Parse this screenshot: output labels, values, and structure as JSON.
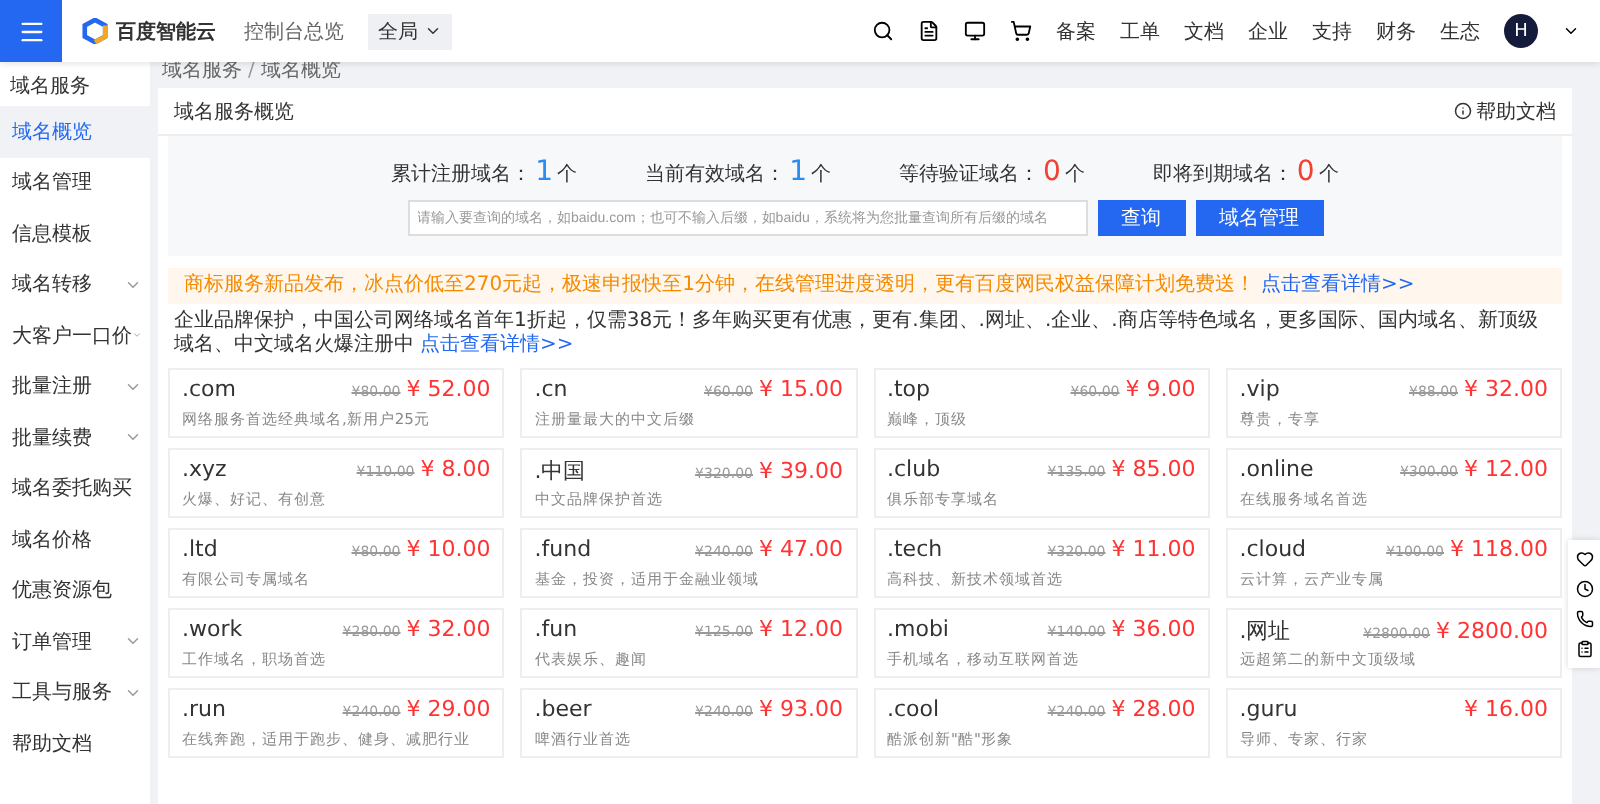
{
  "topbar": {
    "logo": "百度智能云",
    "console": "控制台总览",
    "region": "全局",
    "menu": [
      "备案",
      "工单",
      "文档",
      "企业",
      "支持",
      "财务",
      "生态"
    ],
    "avatar": "H"
  },
  "sidebar": {
    "title": "域名服务",
    "items": [
      {
        "label": "域名概览",
        "selected": true,
        "expandable": false
      },
      {
        "label": "域名管理",
        "selected": false,
        "expandable": false
      },
      {
        "label": "信息模板",
        "selected": false,
        "expandable": false
      },
      {
        "label": "域名转移",
        "selected": false,
        "expandable": true
      },
      {
        "label": "大客户一口价",
        "selected": false,
        "expandable": true
      },
      {
        "label": "批量注册",
        "selected": false,
        "expandable": true
      },
      {
        "label": "批量续费",
        "selected": false,
        "expandable": true
      },
      {
        "label": "域名委托购买",
        "selected": false,
        "expandable": false
      },
      {
        "label": "域名价格",
        "selected": false,
        "expandable": false
      },
      {
        "label": "优惠资源包",
        "selected": false,
        "expandable": false
      },
      {
        "label": "订单管理",
        "selected": false,
        "expandable": true
      },
      {
        "label": "工具与服务",
        "selected": false,
        "expandable": true
      },
      {
        "label": "帮助文档",
        "selected": false,
        "expandable": false
      }
    ]
  },
  "breadcrumb": {
    "items": [
      "域名服务",
      "域名概览"
    ],
    "separator": "/"
  },
  "header": {
    "title": "域名服务概览",
    "help": "帮助文档"
  },
  "stats": [
    {
      "label": "累计注册域名：",
      "value": "1",
      "unit": "个",
      "color": "#2a8cf0"
    },
    {
      "label": "当前有效域名：",
      "value": "1",
      "unit": "个",
      "color": "#2a8cf0"
    },
    {
      "label": "等待验证域名：",
      "value": "0",
      "unit": "个",
      "color": "#f04134"
    },
    {
      "label": "即将到期域名：",
      "value": "0",
      "unit": "个",
      "color": "#f04134"
    }
  ],
  "search": {
    "placeholder": "请输入要查询的域名，如baidu.com；也可不输入后缀，如baidu，系统将为您批量查询所有后缀的域名",
    "buttons": [
      "查询",
      "域名管理"
    ]
  },
  "notices": [
    {
      "text": "商标服务新品发布，冰点价低至270元起，极速申报快至1分钟，在线管理进度透明，更有百度网民权益保障计划免费送！",
      "link": "点击查看详情>>",
      "kind": "warning"
    },
    {
      "text": "企业品牌保护，中国公司网络域名首年1折起，仅需38元！多年购买更有优惠，更有.集团、.网址、.企业、.商店等特色域名，更多国际、国内域名、新顶级域名、中文域名火爆注册中",
      "link": "点击查看详情>>",
      "kind": "plain"
    }
  ],
  "domains": [
    {
      "name": ".com",
      "old": "¥80.00",
      "price": "¥ 52.00",
      "desc": "网络服务首选经典域名,新用户25元"
    },
    {
      "name": ".cn",
      "old": "¥60.00",
      "price": "¥ 15.00",
      "desc": "注册量最大的中文后缀"
    },
    {
      "name": ".top",
      "old": "¥60.00",
      "price": "¥ 9.00",
      "desc": "巅峰，顶级"
    },
    {
      "name": ".vip",
      "old": "¥88.00",
      "price": "¥ 32.00",
      "desc": "尊贵，专享"
    },
    {
      "name": ".xyz",
      "old": "¥110.00",
      "price": "¥ 8.00",
      "desc": "火爆、好记、有创意"
    },
    {
      "name": ".中国",
      "old": "¥320.00",
      "price": "¥ 39.00",
      "desc": "中文品牌保护首选"
    },
    {
      "name": ".club",
      "old": "¥135.00",
      "price": "¥ 85.00",
      "desc": "俱乐部专享域名"
    },
    {
      "name": ".online",
      "old": "¥300.00",
      "price": "¥ 12.00",
      "desc": "在线服务域名首选"
    },
    {
      "name": ".ltd",
      "old": "¥80.00",
      "price": "¥ 10.00",
      "desc": "有限公司专属域名"
    },
    {
      "name": ".fund",
      "old": "¥240.00",
      "price": "¥ 47.00",
      "desc": "基金，投资，适用于金融业领域"
    },
    {
      "name": ".tech",
      "old": "¥320.00",
      "price": "¥ 11.00",
      "desc": "高科技、新技术领域首选"
    },
    {
      "name": ".cloud",
      "old": "¥100.00",
      "price": "¥ 118.00",
      "desc": "云计算，云产业专属"
    },
    {
      "name": ".work",
      "old": "¥280.00",
      "price": "¥ 32.00",
      "desc": "工作域名，职场首选"
    },
    {
      "name": ".fun",
      "old": "¥125.00",
      "price": "¥ 12.00",
      "desc": "代表娱乐、趣闻"
    },
    {
      "name": ".mobi",
      "old": "¥140.00",
      "price": "¥ 36.00",
      "desc": "手机域名，移动互联网首选"
    },
    {
      "name": ".网址",
      "old": "¥2800.00",
      "price": "¥ 2800.00",
      "desc": "远超第二的新中文顶级域"
    },
    {
      "name": ".run",
      "old": "¥240.00",
      "price": "¥ 29.00",
      "desc": "在线奔跑，适用于跑步、健身、减肥行业"
    },
    {
      "name": ".beer",
      "old": "¥240.00",
      "price": "¥ 93.00",
      "desc": "啤酒行业首选"
    },
    {
      "name": ".cool",
      "old": "¥240.00",
      "price": "¥ 28.00",
      "desc": "酷派创新\"酷\"形象"
    },
    {
      "name": ".guru",
      "price": "¥ 16.00",
      "desc": "导师、专家、行家"
    }
  ]
}
